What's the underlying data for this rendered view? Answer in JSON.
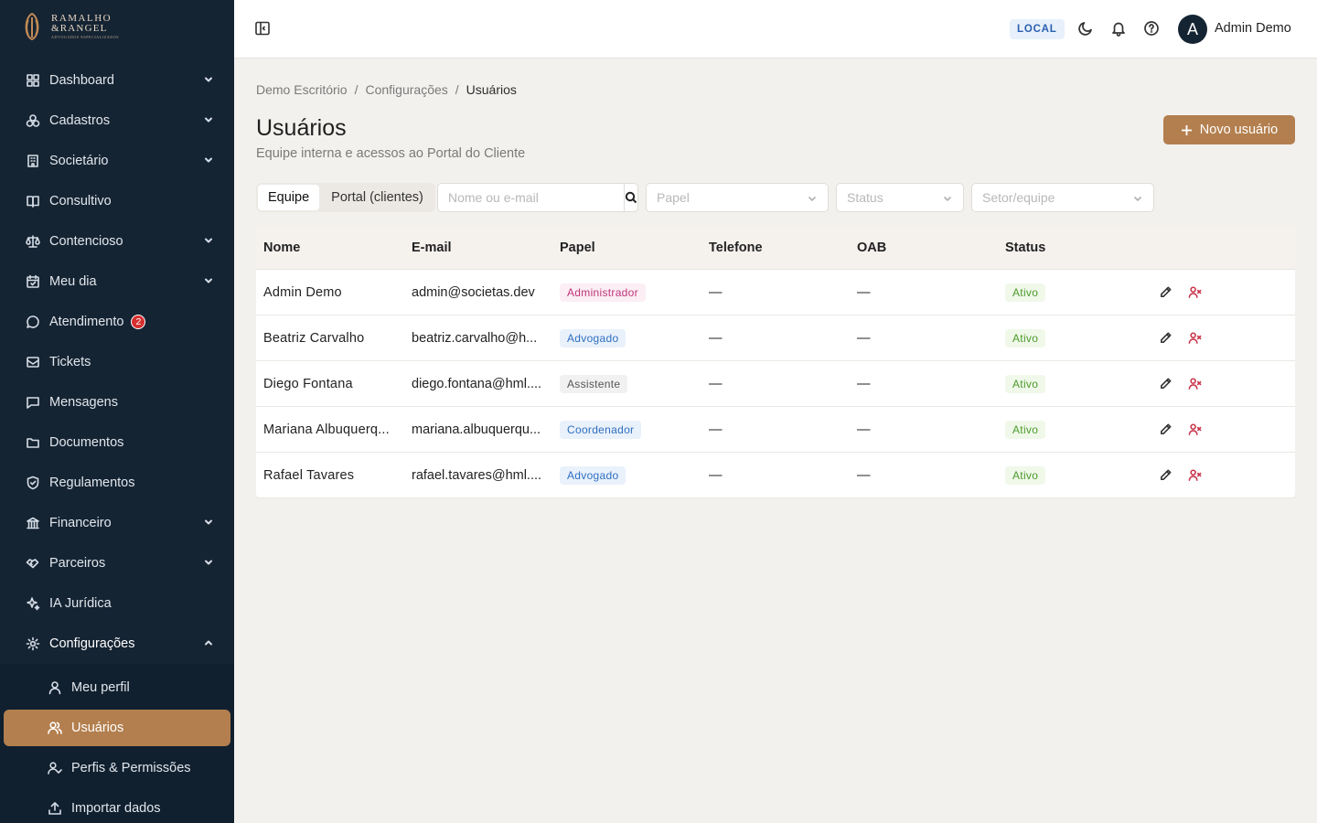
{
  "brand": {
    "line1": "RAMALHO",
    "line2": "&RANGEL",
    "line3": "ADVOGADOS ESPECIALIZADOS"
  },
  "sidebar": {
    "items": [
      {
        "label": "Dashboard",
        "icon": "dashboard-icon",
        "chevron": "down"
      },
      {
        "label": "Cadastros",
        "icon": "boxes-icon",
        "chevron": "down"
      },
      {
        "label": "Societário",
        "icon": "building-icon",
        "chevron": "down"
      },
      {
        "label": "Consultivo",
        "icon": "book-icon"
      },
      {
        "label": "Contencioso",
        "icon": "scale-icon",
        "chevron": "down"
      },
      {
        "label": "Meu dia",
        "icon": "calendar-icon",
        "chevron": "down"
      },
      {
        "label": "Atendimento",
        "icon": "chat-icon",
        "badge": "2"
      },
      {
        "label": "Tickets",
        "icon": "ticket-icon"
      },
      {
        "label": "Mensagens",
        "icon": "message-icon"
      },
      {
        "label": "Documentos",
        "icon": "folder-icon"
      },
      {
        "label": "Regulamentos",
        "icon": "shield-icon"
      },
      {
        "label": "Financeiro",
        "icon": "bank-icon",
        "chevron": "down"
      },
      {
        "label": "Parceiros",
        "icon": "handshake-icon",
        "chevron": "down"
      },
      {
        "label": "IA Jurídica",
        "icon": "sparkles-icon"
      },
      {
        "label": "Configurações",
        "icon": "gear-icon",
        "chevron": "up"
      }
    ],
    "sub_items": [
      {
        "label": "Meu perfil",
        "icon": "user-icon"
      },
      {
        "label": "Usuários",
        "icon": "users-icon"
      },
      {
        "label": "Perfis & Permissões",
        "icon": "user-check-icon"
      },
      {
        "label": "Importar dados",
        "icon": "upload-icon"
      }
    ]
  },
  "header": {
    "env_badge": "LOCAL",
    "avatar_initial": "A",
    "user_name": "Admin Demo"
  },
  "breadcrumb": [
    "Demo Escritório",
    "/",
    "Configurações",
    "/",
    "Usuários"
  ],
  "page": {
    "title": "Usuários",
    "subtitle": "Equipe interna e acessos ao Portal do Cliente",
    "new_button": "Novo usuário"
  },
  "filters": {
    "tabs": [
      "Equipe",
      "Portal (clientes)"
    ],
    "search_placeholder": "Nome ou e-mail",
    "role_placeholder": "Papel",
    "status_placeholder": "Status",
    "sector_placeholder": "Setor/equipe"
  },
  "table": {
    "columns": [
      "Nome",
      "E-mail",
      "Papel",
      "Telefone",
      "OAB",
      "Status"
    ],
    "rows": [
      {
        "name": "Admin Demo",
        "email": "admin@societas.dev",
        "role": "Administrador",
        "phone": "—",
        "oab": "—",
        "status": "Ativo"
      },
      {
        "name": "Beatriz Carvalho",
        "email": "beatriz.carvalho@h...",
        "role": "Advogado",
        "phone": "—",
        "oab": "—",
        "status": "Ativo"
      },
      {
        "name": "Diego Fontana",
        "email": "diego.fontana@hml....",
        "role": "Assistente",
        "phone": "—",
        "oab": "—",
        "status": "Ativo"
      },
      {
        "name": "Mariana Albuquerq...",
        "email": "mariana.albuquerqu...",
        "role": "Coordenador",
        "phone": "—",
        "oab": "—",
        "status": "Ativo"
      },
      {
        "name": "Rafael Tavares",
        "email": "rafael.tavares@hml....",
        "role": "Advogado",
        "phone": "—",
        "oab": "—",
        "status": "Ativo"
      }
    ]
  },
  "colors": {
    "sidebar_bg": "#152433",
    "accent": "#b37f4e",
    "role_admin": "#c0357a",
    "role_advogado": "#2f6fc0",
    "role_assistente": "#555555",
    "role_coordenador": "#2f6fc0",
    "status_active": "#4c9b2a",
    "remove_user": "#c9354a"
  }
}
